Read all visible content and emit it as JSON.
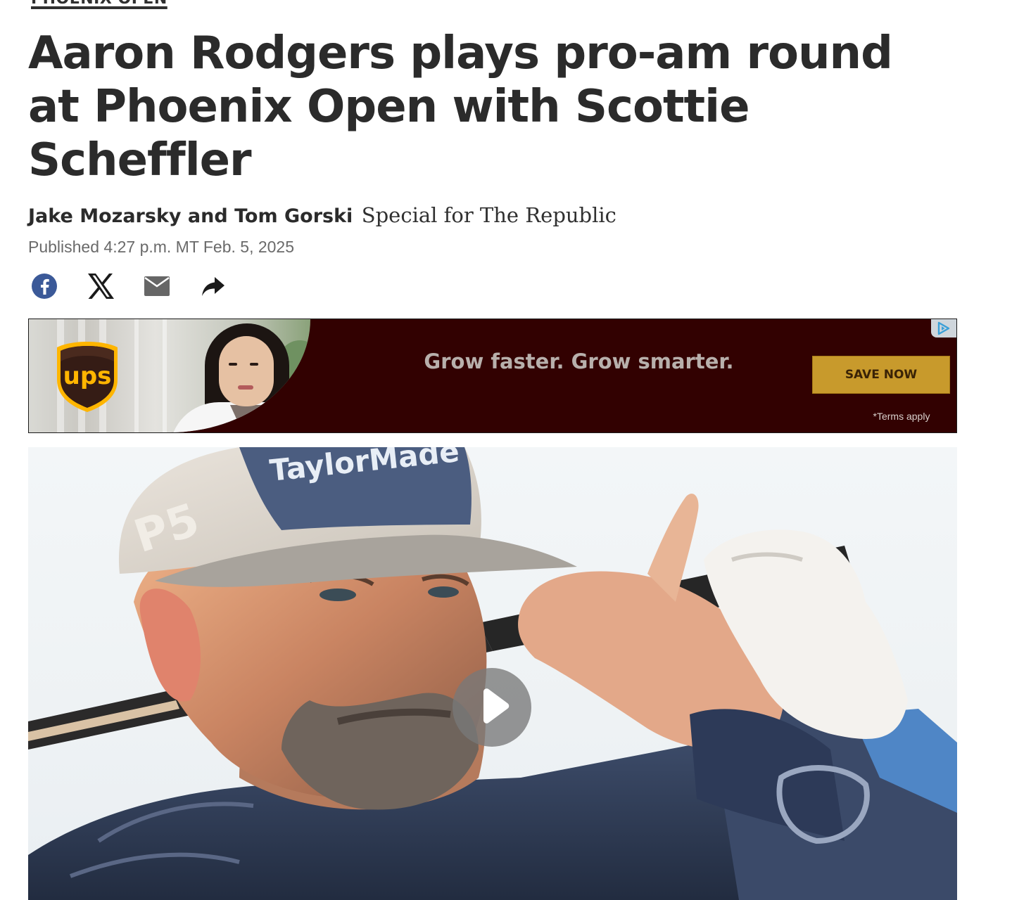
{
  "section": {
    "label": "PHOENIX OPEN"
  },
  "article": {
    "headline": "Aaron Rodgers plays pro-am round at Phoenix Open with Scottie Scheffler",
    "authors": "Jake Mozarsky and Tom Gorski",
    "affiliation": "Special for The Republic",
    "published": "Published 4:27 p.m. MT Feb. 5, 2025"
  },
  "share": {
    "icons": [
      "facebook-icon",
      "x-icon",
      "email-icon",
      "share-icon"
    ]
  },
  "ad": {
    "brand_logo_text": "ups",
    "headline": "Grow faster. Grow smarter.",
    "cta_label": "SAVE NOW",
    "terms": "*Terms apply",
    "colors": {
      "background": "#320101",
      "cta": "#c89a2c",
      "ups_brown": "#351c15",
      "ups_gold": "#ffb500"
    }
  },
  "video": {
    "cap_brand_text": "TaylorMade",
    "cap_side_text": "P5",
    "play_icon": "play-icon"
  }
}
